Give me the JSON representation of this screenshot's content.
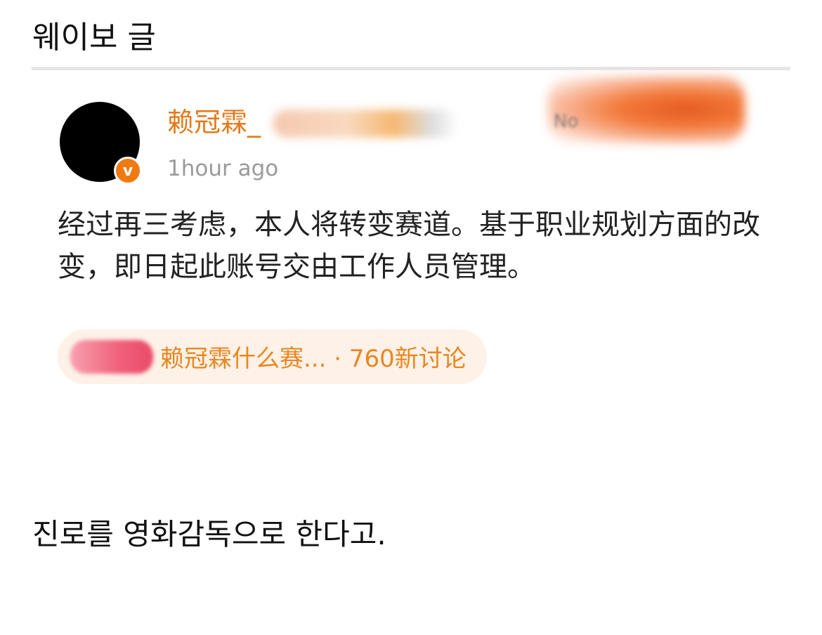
{
  "page": {
    "title": "웨이보 글"
  },
  "post": {
    "username": "赖冠霖_",
    "username_color": "#e27a1a",
    "verified_icon": "v",
    "verified_color": "#f07a12",
    "timestamp": "1hour ago",
    "follow_text": "No",
    "body": "经过再三考虑，本人将转变赛道。基于职业规划方面的改变，即日起此账号交由工作人员管理。"
  },
  "topic": {
    "text": "赖冠霖什么赛... · 760新讨论",
    "color": "#e8871e"
  },
  "comment": {
    "text": "진로를 영화감독으로 한다고."
  }
}
